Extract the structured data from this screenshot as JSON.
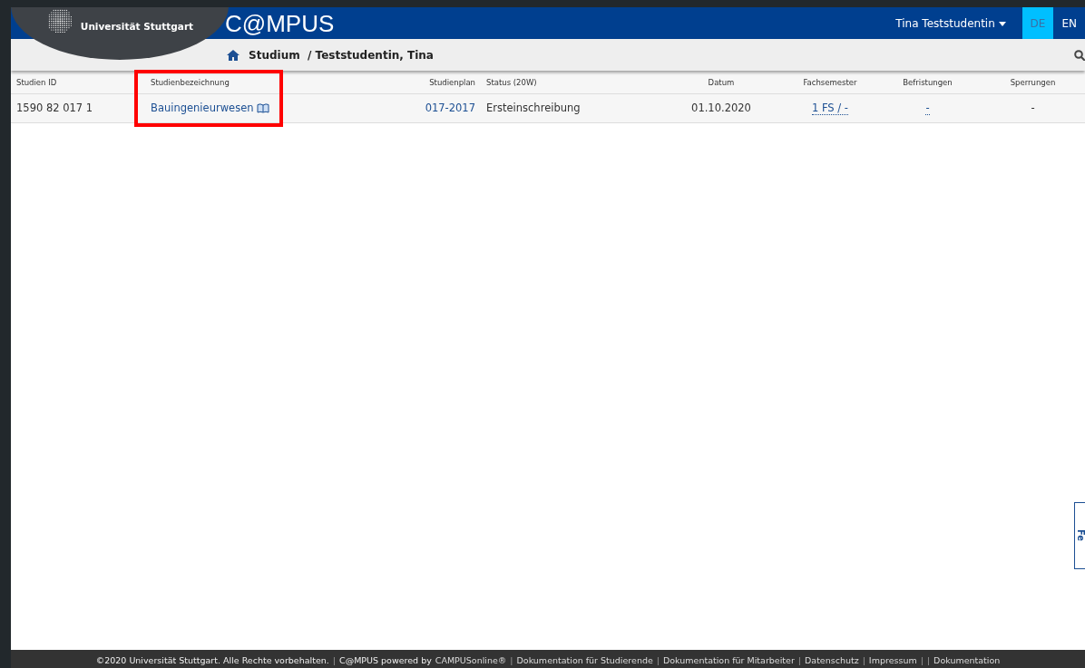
{
  "header": {
    "university": "Universität Stuttgart",
    "app_title": "C@MPUS",
    "user": "Tina Teststudentin",
    "languages": [
      {
        "label": "DE",
        "selected": true
      },
      {
        "label": "EN",
        "selected": false
      }
    ]
  },
  "breadcrumb": {
    "section": "Studium",
    "person": "/ Teststudentin, Tina"
  },
  "table": {
    "columns": [
      "Studien ID",
      "Studienbezeichnung",
      "Studienplan",
      "Status (20W)",
      "Datum",
      "Fachsemester",
      "Befristungen",
      "Sperrungen"
    ],
    "rows": [
      {
        "cells": [
          {
            "text": "1590 82 017 1",
            "kind": "plain"
          },
          {
            "text": "Bauingenieurwesen",
            "kind": "link-book",
            "highlighted": true
          },
          {
            "text": "017-2017",
            "kind": "link"
          },
          {
            "text": "Ersteinschreibung",
            "kind": "plain"
          },
          {
            "text": "01.10.2020",
            "kind": "plain"
          },
          {
            "text": "1 FS / -",
            "kind": "dotted-link"
          },
          {
            "text": "-",
            "kind": "dotted-link"
          },
          {
            "text": "-",
            "kind": "plain"
          }
        ]
      }
    ]
  },
  "feedback_tab": {
    "label": "Fe"
  },
  "footer": {
    "items": [
      {
        "text": "©2020 Universität Stuttgart. Alle Rechte vorbehalten.",
        "kind": "text"
      },
      {
        "text": "|",
        "kind": "separator"
      },
      {
        "text": "C@MPUS powered by",
        "kind": "text"
      },
      {
        "text": "CAMPUSonline®",
        "kind": "link"
      },
      {
        "text": "|",
        "kind": "separator"
      },
      {
        "text": "Dokumentation für Studierende",
        "kind": "link"
      },
      {
        "text": "|",
        "kind": "separator"
      },
      {
        "text": "Dokumentation für Mitarbeiter",
        "kind": "link"
      },
      {
        "text": "|",
        "kind": "separator"
      },
      {
        "text": "Datenschutz",
        "kind": "link"
      },
      {
        "text": "|",
        "kind": "separator"
      },
      {
        "text": "Impressum",
        "kind": "link"
      },
      {
        "text": "|",
        "kind": "separator"
      },
      {
        "text": "|",
        "kind": "separator"
      },
      {
        "text": "Dokumentation",
        "kind": "link"
      }
    ]
  }
}
